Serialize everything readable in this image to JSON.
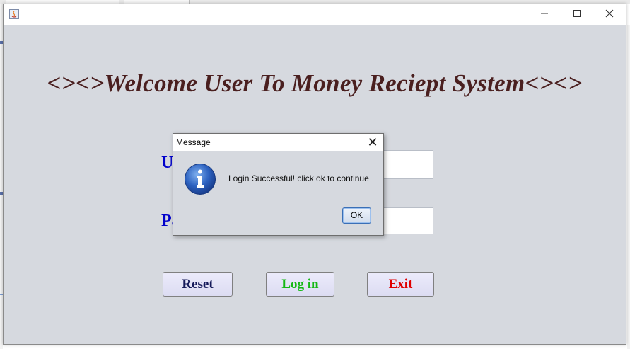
{
  "window": {
    "minimize_icon": "minimize-icon",
    "maximize_icon": "maximize-icon",
    "close_icon": "close-icon",
    "app_icon": "java-icon"
  },
  "main": {
    "heading": "<><>Welcome User To Money Reciept System<><>",
    "username_label_visible": "U",
    "password_label_visible": "Pa",
    "username_value": "",
    "password_value": ""
  },
  "buttons": {
    "reset": "Reset",
    "login": "Log in",
    "exit": "Exit"
  },
  "dialog": {
    "title": "Message",
    "message": "Login Successful! click ok to continue",
    "ok": "OK",
    "close_glyph": "✕",
    "icon": "information-icon"
  },
  "colors": {
    "heading": "#4a1f1f",
    "labels": "#0000cc",
    "reset_text": "#151a5a",
    "login_text": "#14b814",
    "exit_text": "#e00000",
    "background": "#d6d9df"
  }
}
